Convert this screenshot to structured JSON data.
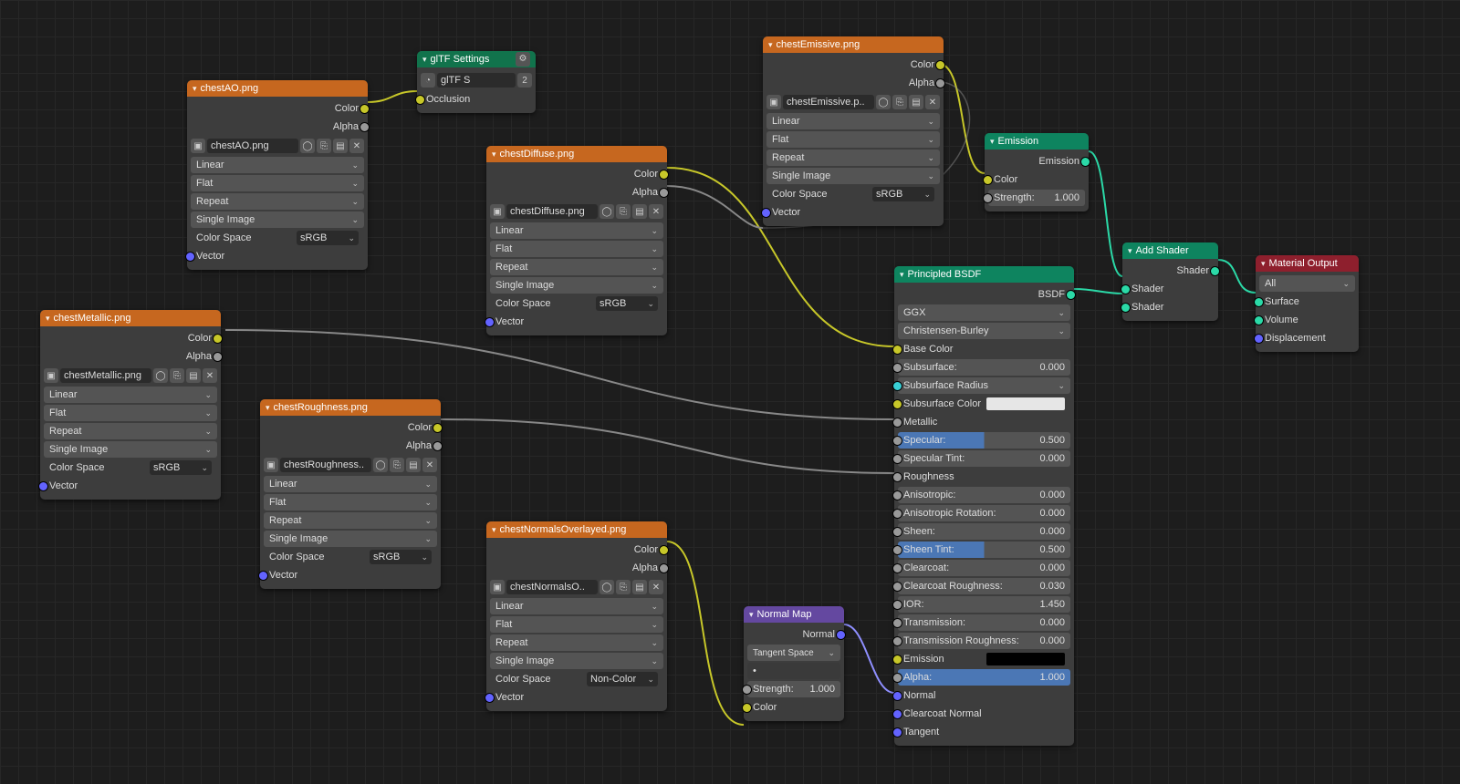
{
  "nodes": {
    "ao": {
      "title": "chestAO.png",
      "file": "chestAO.png",
      "interp": "Linear",
      "proj": "Flat",
      "ext": "Repeat",
      "src": "Single Image",
      "cs_label": "Color Space",
      "cs": "sRGB",
      "out_color": "Color",
      "out_alpha": "Alpha",
      "in_vector": "Vector"
    },
    "metallic": {
      "title": "chestMetallic.png",
      "file": "chestMetallic.png",
      "interp": "Linear",
      "proj": "Flat",
      "ext": "Repeat",
      "src": "Single Image",
      "cs_label": "Color Space",
      "cs": "sRGB",
      "out_color": "Color",
      "out_alpha": "Alpha",
      "in_vector": "Vector"
    },
    "roughness": {
      "title": "chestRoughness.png",
      "file": "chestRoughness..",
      "interp": "Linear",
      "proj": "Flat",
      "ext": "Repeat",
      "src": "Single Image",
      "cs_label": "Color Space",
      "cs": "sRGB",
      "out_color": "Color",
      "out_alpha": "Alpha",
      "in_vector": "Vector"
    },
    "diffuse": {
      "title": "chestDiffuse.png",
      "file": "chestDiffuse.png",
      "interp": "Linear",
      "proj": "Flat",
      "ext": "Repeat",
      "src": "Single Image",
      "cs_label": "Color Space",
      "cs": "sRGB",
      "out_color": "Color",
      "out_alpha": "Alpha",
      "in_vector": "Vector"
    },
    "normals": {
      "title": "chestNormalsOverlayed.png",
      "file": "chestNormalsO..",
      "interp": "Linear",
      "proj": "Flat",
      "ext": "Repeat",
      "src": "Single Image",
      "cs_label": "Color Space",
      "cs": "Non-Color",
      "out_color": "Color",
      "out_alpha": "Alpha",
      "in_vector": "Vector"
    },
    "emissive": {
      "title": "chestEmissive.png",
      "file": "chestEmissive.p..",
      "interp": "Linear",
      "proj": "Flat",
      "ext": "Repeat",
      "src": "Single Image",
      "cs_label": "Color Space",
      "cs": "sRGB",
      "out_color": "Color",
      "out_alpha": "Alpha",
      "in_vector": "Vector"
    },
    "gltf": {
      "title": "glTF Settings",
      "field": "glTF S",
      "count": "2",
      "occlusion": "Occlusion"
    },
    "emission": {
      "title": "Emission",
      "out": "Emission",
      "in_color": "Color",
      "strength_label": "Strength:",
      "strength_val": "1.000"
    },
    "addshader": {
      "title": "Add Shader",
      "out": "Shader",
      "in1": "Shader",
      "in2": "Shader"
    },
    "normalmap": {
      "title": "Normal Map",
      "out": "Normal",
      "space": "Tangent Space",
      "strength_label": "Strength:",
      "strength_val": "1.000",
      "in_color": "Color"
    },
    "matout": {
      "title": "Material Output",
      "target": "All",
      "surface": "Surface",
      "volume": "Volume",
      "displacement": "Displacement"
    },
    "bsdf": {
      "title": "Principled BSDF",
      "out": "BSDF",
      "dist": "GGX",
      "sss": "Christensen-Burley",
      "rows": [
        {
          "label": "Base Color",
          "kind": "label",
          "sock": "c-yellow"
        },
        {
          "label": "Subsurface:",
          "val": "0.000",
          "kind": "slider",
          "sock": "c-grey"
        },
        {
          "label": "Subsurface Radius",
          "kind": "dropdown",
          "sock": "c-cyan"
        },
        {
          "label": "Subsurface Color",
          "kind": "swatch",
          "swatch": "#e6e6e6",
          "sock": "c-yellow"
        },
        {
          "label": "Metallic",
          "kind": "label",
          "sock": "c-grey"
        },
        {
          "label": "Specular:",
          "val": "0.500",
          "kind": "blue",
          "sock": "c-grey"
        },
        {
          "label": "Specular Tint:",
          "val": "0.000",
          "kind": "slider",
          "sock": "c-grey"
        },
        {
          "label": "Roughness",
          "kind": "label",
          "sock": "c-grey"
        },
        {
          "label": "Anisotropic:",
          "val": "0.000",
          "kind": "slider",
          "sock": "c-grey"
        },
        {
          "label": "Anisotropic Rotation:",
          "val": "0.000",
          "kind": "slider",
          "sock": "c-grey"
        },
        {
          "label": "Sheen:",
          "val": "0.000",
          "kind": "slider",
          "sock": "c-grey"
        },
        {
          "label": "Sheen Tint:",
          "val": "0.500",
          "kind": "blue",
          "sock": "c-grey"
        },
        {
          "label": "Clearcoat:",
          "val": "0.000",
          "kind": "slider",
          "sock": "c-grey"
        },
        {
          "label": "Clearcoat Roughness:",
          "val": "0.030",
          "kind": "slider",
          "sock": "c-grey"
        },
        {
          "label": "IOR:",
          "val": "1.450",
          "kind": "slider",
          "sock": "c-grey"
        },
        {
          "label": "Transmission:",
          "val": "0.000",
          "kind": "slider",
          "sock": "c-grey"
        },
        {
          "label": "Transmission Roughness:",
          "val": "0.000",
          "kind": "slider",
          "sock": "c-grey"
        },
        {
          "label": "Emission",
          "kind": "swatch",
          "swatch": "#000000",
          "sock": "c-yellow"
        },
        {
          "label": "Alpha:",
          "val": "1.000",
          "kind": "blue-full",
          "sock": "c-grey"
        },
        {
          "label": "Normal",
          "kind": "label",
          "sock": "c-blue"
        },
        {
          "label": "Clearcoat Normal",
          "kind": "label",
          "sock": "c-blue"
        },
        {
          "label": "Tangent",
          "kind": "label",
          "sock": "c-blue"
        }
      ]
    }
  }
}
